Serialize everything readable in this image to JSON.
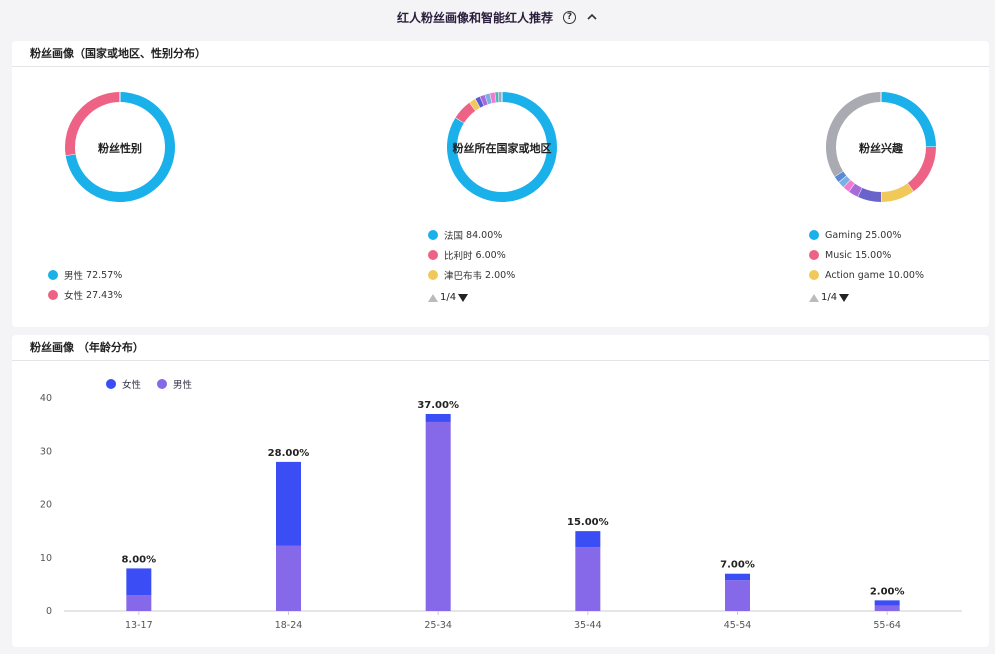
{
  "header": {
    "title": "红人粉丝画像和智能红人推荐",
    "help_glyph": "?"
  },
  "section1": {
    "title": "粉丝画像（国家或地区、性别分布）"
  },
  "section2": {
    "title": "粉丝画像  （年龄分布）"
  },
  "donut_gender": {
    "center_label": "粉丝性别",
    "slices": [
      {
        "label": "男性",
        "pct": "72.57%",
        "value": 72.57,
        "color": "#1ab0ea"
      },
      {
        "label": "女性",
        "pct": "27.43%",
        "value": 27.43,
        "color": "#ee6385"
      }
    ]
  },
  "donut_country": {
    "center_label": "粉丝所在国家或地区",
    "legend": [
      {
        "label": "法国",
        "pct": "84.00%",
        "color": "#1ab0ea"
      },
      {
        "label": "比利时",
        "pct": "6.00%",
        "color": "#ee6385"
      },
      {
        "label": "津巴布韦",
        "pct": "2.00%",
        "color": "#f1c95a"
      }
    ],
    "slices": [
      {
        "value": 84,
        "color": "#1ab0ea"
      },
      {
        "value": 6,
        "color": "#ee6385"
      },
      {
        "value": 2,
        "color": "#f1c95a"
      },
      {
        "value": 1.5,
        "color": "#5a5ad6"
      },
      {
        "value": 1.5,
        "color": "#a66bd8"
      },
      {
        "value": 1.5,
        "color": "#7ab0e6"
      },
      {
        "value": 1.5,
        "color": "#f07bd0"
      },
      {
        "value": 1,
        "color": "#4ab8b0"
      },
      {
        "value": 1,
        "color": "#9aa6c8"
      }
    ],
    "pager": {
      "current": "1/4"
    }
  },
  "donut_interest": {
    "center_label": "粉丝兴趣",
    "legend": [
      {
        "label": "Gaming",
        "pct": "25.00%",
        "color": "#1ab0ea"
      },
      {
        "label": "Music",
        "pct": "15.00%",
        "color": "#ee6385"
      },
      {
        "label": "Action game",
        "pct": "10.00%",
        "color": "#f1c95a"
      }
    ],
    "slices": [
      {
        "value": 25,
        "color": "#1ab0ea"
      },
      {
        "value": 15,
        "color": "#ee6385"
      },
      {
        "value": 10,
        "color": "#f1c95a"
      },
      {
        "value": 7,
        "color": "#6a63c9"
      },
      {
        "value": 3,
        "color": "#a66bd8"
      },
      {
        "value": 2,
        "color": "#f07bd0"
      },
      {
        "value": 2,
        "color": "#7ab0e6"
      },
      {
        "value": 2,
        "color": "#5a8ad6"
      },
      {
        "value": 34,
        "color": "#a9aab2"
      }
    ],
    "pager": {
      "current": "1/4"
    }
  },
  "chart_data": {
    "type": "bar",
    "stacked": true,
    "categories": [
      "13-17",
      "18-24",
      "25-34",
      "35-44",
      "45-54",
      "55-64"
    ],
    "series": [
      {
        "name": "男性",
        "values": [
          3,
          12.3,
          35.5,
          12,
          5.8,
          1
        ],
        "color": "#8569e8"
      },
      {
        "name": "女性",
        "values": [
          5,
          15.7,
          1.5,
          3,
          1.2,
          1
        ],
        "color": "#3b4ef5"
      }
    ],
    "totals_labels": [
      "8.00%",
      "28.00%",
      "37.00%",
      "15.00%",
      "7.00%",
      "2.00%"
    ],
    "totals": [
      8,
      28,
      37,
      15,
      7,
      2
    ],
    "yticks": [
      "0",
      "10",
      "20",
      "30",
      "40"
    ],
    "ylim": [
      0,
      40
    ],
    "legend": [
      {
        "name": "女性",
        "color": "#3b4ef5"
      },
      {
        "name": "男性",
        "color": "#8569e8"
      }
    ],
    "legend_position": "top-left",
    "grid": false
  }
}
